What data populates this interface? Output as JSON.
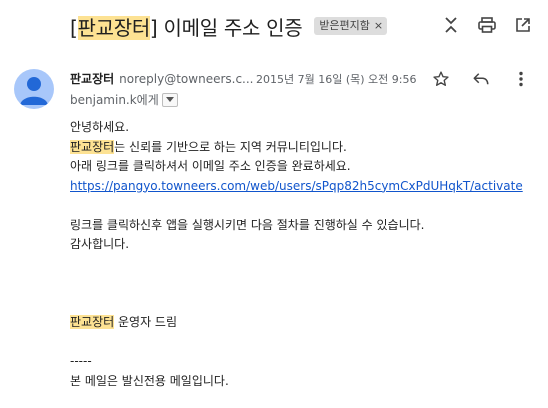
{
  "subject": {
    "bracket_open": "[",
    "brand": "판교장터",
    "bracket_close": "]",
    "title": " 이메일 주소 인증",
    "label_chip": "받은편지함"
  },
  "toolbar": {
    "icons": [
      "expand-collapse-icon",
      "print-icon",
      "open-in-new-window-icon"
    ]
  },
  "sender": {
    "name": "판교장터",
    "email": "noreply@towneers.c...",
    "date": "2015년 7월 16일 (목) 오전 9:56",
    "to": "benjamin.k에게"
  },
  "sender_actions": {
    "icons": [
      "star-icon",
      "reply-icon",
      "more-vert-icon"
    ]
  },
  "body": {
    "greeting": "안녕하세요.",
    "brand1": "판교장터",
    "intro_rest": "는 신뢰를 기반으로 하는 지역 커뮤니티입니다.",
    "instruction": "아래 링크를 클릭하셔서 이메일 주소 인증을 완료하세요.",
    "link": "https://pangyo.towneers.com/web/users/sPqp82h5cymCxPdUHqkT/activate",
    "after_click": "링크를 클릭하신후 앱을 실행시키면 다음 절차를 진행하실 수 있습니다.",
    "thanks": "감사합니다.",
    "brand2": "판교장터",
    "signoff_rest": " 운영자 드림",
    "separator": "-----",
    "footer": "본 메일은 발신전용 메일입니다."
  },
  "colors": {
    "highlight": "#fde293",
    "link": "#1155cc",
    "avatar": "#a8c7fa"
  }
}
